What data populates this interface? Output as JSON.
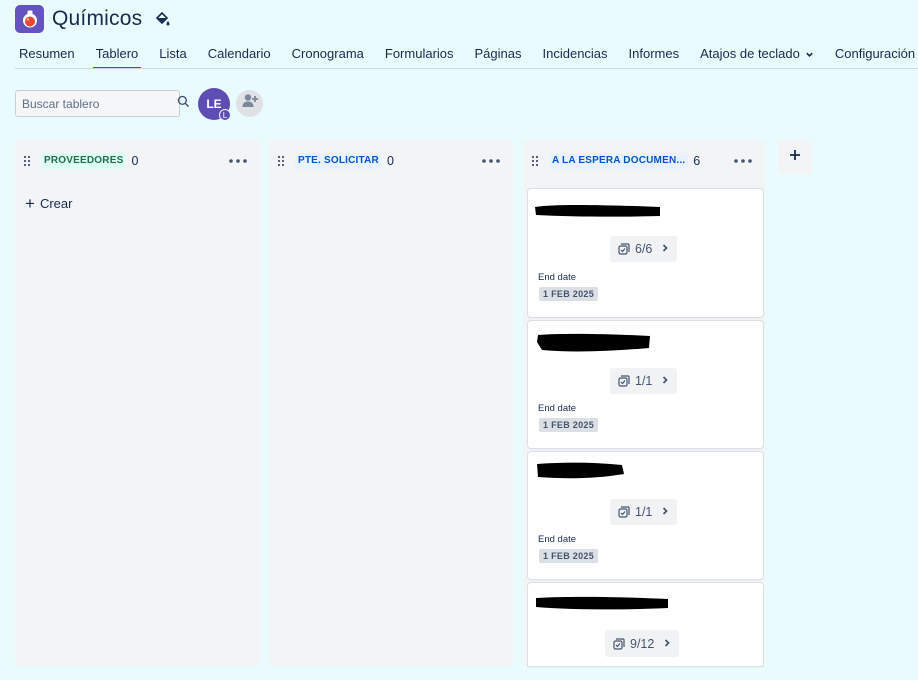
{
  "project": {
    "title": "Químicos",
    "logo_icon": "flask-icon",
    "theme_icon": "paint-bucket-icon"
  },
  "tabs": [
    {
      "label": "Resumen"
    },
    {
      "label": "Tablero",
      "active": true
    },
    {
      "label": "Lista"
    },
    {
      "label": "Calendario"
    },
    {
      "label": "Cronograma"
    },
    {
      "label": "Formularios"
    },
    {
      "label": "Páginas"
    },
    {
      "label": "Incidencias"
    },
    {
      "label": "Informes"
    },
    {
      "label": "Atajos de teclado",
      "dropdown": true
    },
    {
      "label": "Configuración d"
    }
  ],
  "search": {
    "placeholder": "Buscar tablero"
  },
  "avatar": {
    "initials": "LE",
    "badge": "L",
    "color": "#5e4db2"
  },
  "columns": [
    {
      "name": "PROVEEDORES",
      "count": "0",
      "lozenge_bg": "#dcfff1",
      "lozenge_fg": "#216e4e",
      "create_label": "Crear"
    },
    {
      "name": "PTE. SOLICITAR",
      "count": "0",
      "lozenge_bg": "#e9f2ff",
      "lozenge_fg": "#0055cc"
    },
    {
      "name": "A LA ESPERA DOCUMEN...",
      "count": "6",
      "lozenge_bg": "#e9f2ff",
      "lozenge_fg": "#0055cc"
    }
  ],
  "cards": [
    {
      "subtasks": "6/6",
      "end_label": "End date",
      "end_date": "1 FEB 2025"
    },
    {
      "subtasks": "1/1",
      "end_label": "End date",
      "end_date": "1 FEB 2025"
    },
    {
      "subtasks": "1/1",
      "end_label": "End date",
      "end_date": "1 FEB 2025"
    },
    {
      "subtasks": "9/12"
    }
  ],
  "colors": {
    "background": "#e9fbfd",
    "accent": "#0c66e4",
    "column_bg": "#f2f4f6"
  }
}
